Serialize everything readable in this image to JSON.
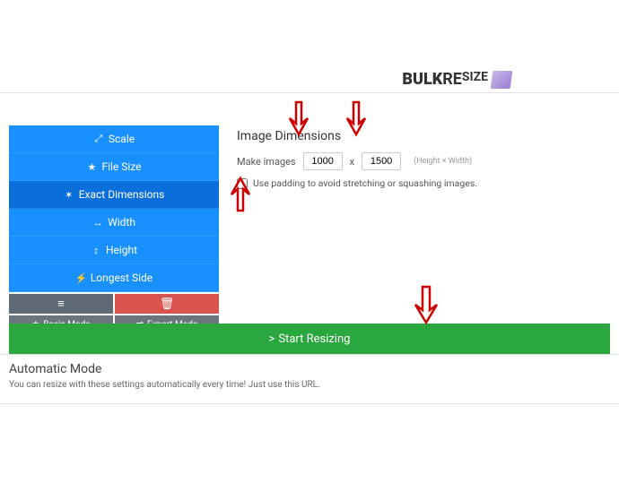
{
  "logo": {
    "bulk": "BULK",
    "re": "RE",
    "size": "SIZE"
  },
  "sidebar": {
    "options": [
      {
        "icon": "⤢",
        "label": "Scale"
      },
      {
        "icon": "★",
        "label": "File Size"
      },
      {
        "icon": "✶",
        "label": "Exact Dimensions"
      },
      {
        "icon": "↔",
        "label": "Width"
      },
      {
        "icon": "↕",
        "label": "Height"
      },
      {
        "icon": "⚡",
        "label": "Longest Side"
      }
    ],
    "list_icon": "≡",
    "trash_icon": "🗑",
    "basic_icon": "★",
    "basic_label": "Basic Mode",
    "expert_icon": "⇄",
    "expert_label": "Expert Mode"
  },
  "dimensions": {
    "title": "Image Dimensions",
    "make_label": "Make images",
    "width_value": "1000",
    "x_label": "x",
    "height_value": "1500",
    "hint": "(Height  ×  Width)",
    "padding_label": "Use padding to avoid stretching or squashing images."
  },
  "start": {
    "chevron": ">",
    "label": "Start Resizing"
  },
  "auto": {
    "title": "Automatic Mode",
    "text": "You can resize with these settings automatically every time! Just use this URL."
  }
}
